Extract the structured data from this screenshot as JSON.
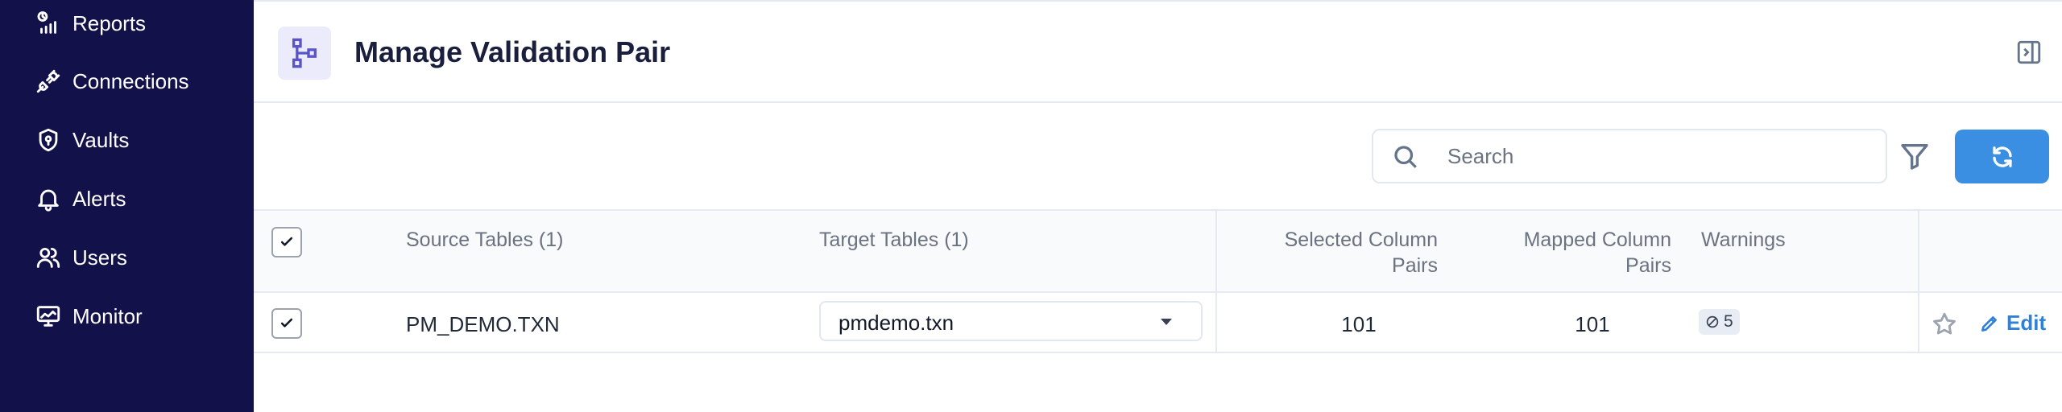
{
  "sidebar": {
    "items": [
      {
        "label": "Reports",
        "icon": "reports-icon"
      },
      {
        "label": "Connections",
        "icon": "plug-icon"
      },
      {
        "label": "Vaults",
        "icon": "shield-icon"
      },
      {
        "label": "Alerts",
        "icon": "bell-icon"
      },
      {
        "label": "Users",
        "icon": "users-icon"
      },
      {
        "label": "Monitor",
        "icon": "monitor-icon"
      }
    ]
  },
  "header": {
    "title": "Manage Validation Pair",
    "icon": "hierarchy-icon"
  },
  "toolbar": {
    "search_placeholder": "Search",
    "filter_icon": "filter-icon",
    "refresh_icon": "refresh-icon"
  },
  "table": {
    "columns": {
      "source": "Source Tables (1)",
      "target": "Target Tables (1)",
      "selected_line1": "Selected Column",
      "selected_line2": "Pairs",
      "mapped_line1": "Mapped Column",
      "mapped_line2": "Pairs",
      "warnings": "Warnings"
    },
    "rows": [
      {
        "checked": true,
        "source": "PM_DEMO.TXN",
        "target": "pmdemo.txn",
        "selected_pairs": "101",
        "mapped_pairs": "101",
        "warnings": "5",
        "edit_label": "Edit"
      }
    ]
  },
  "colors": {
    "sidebar_bg": "#12114a",
    "accent": "#3b8fe2",
    "link": "#2f80d8"
  }
}
